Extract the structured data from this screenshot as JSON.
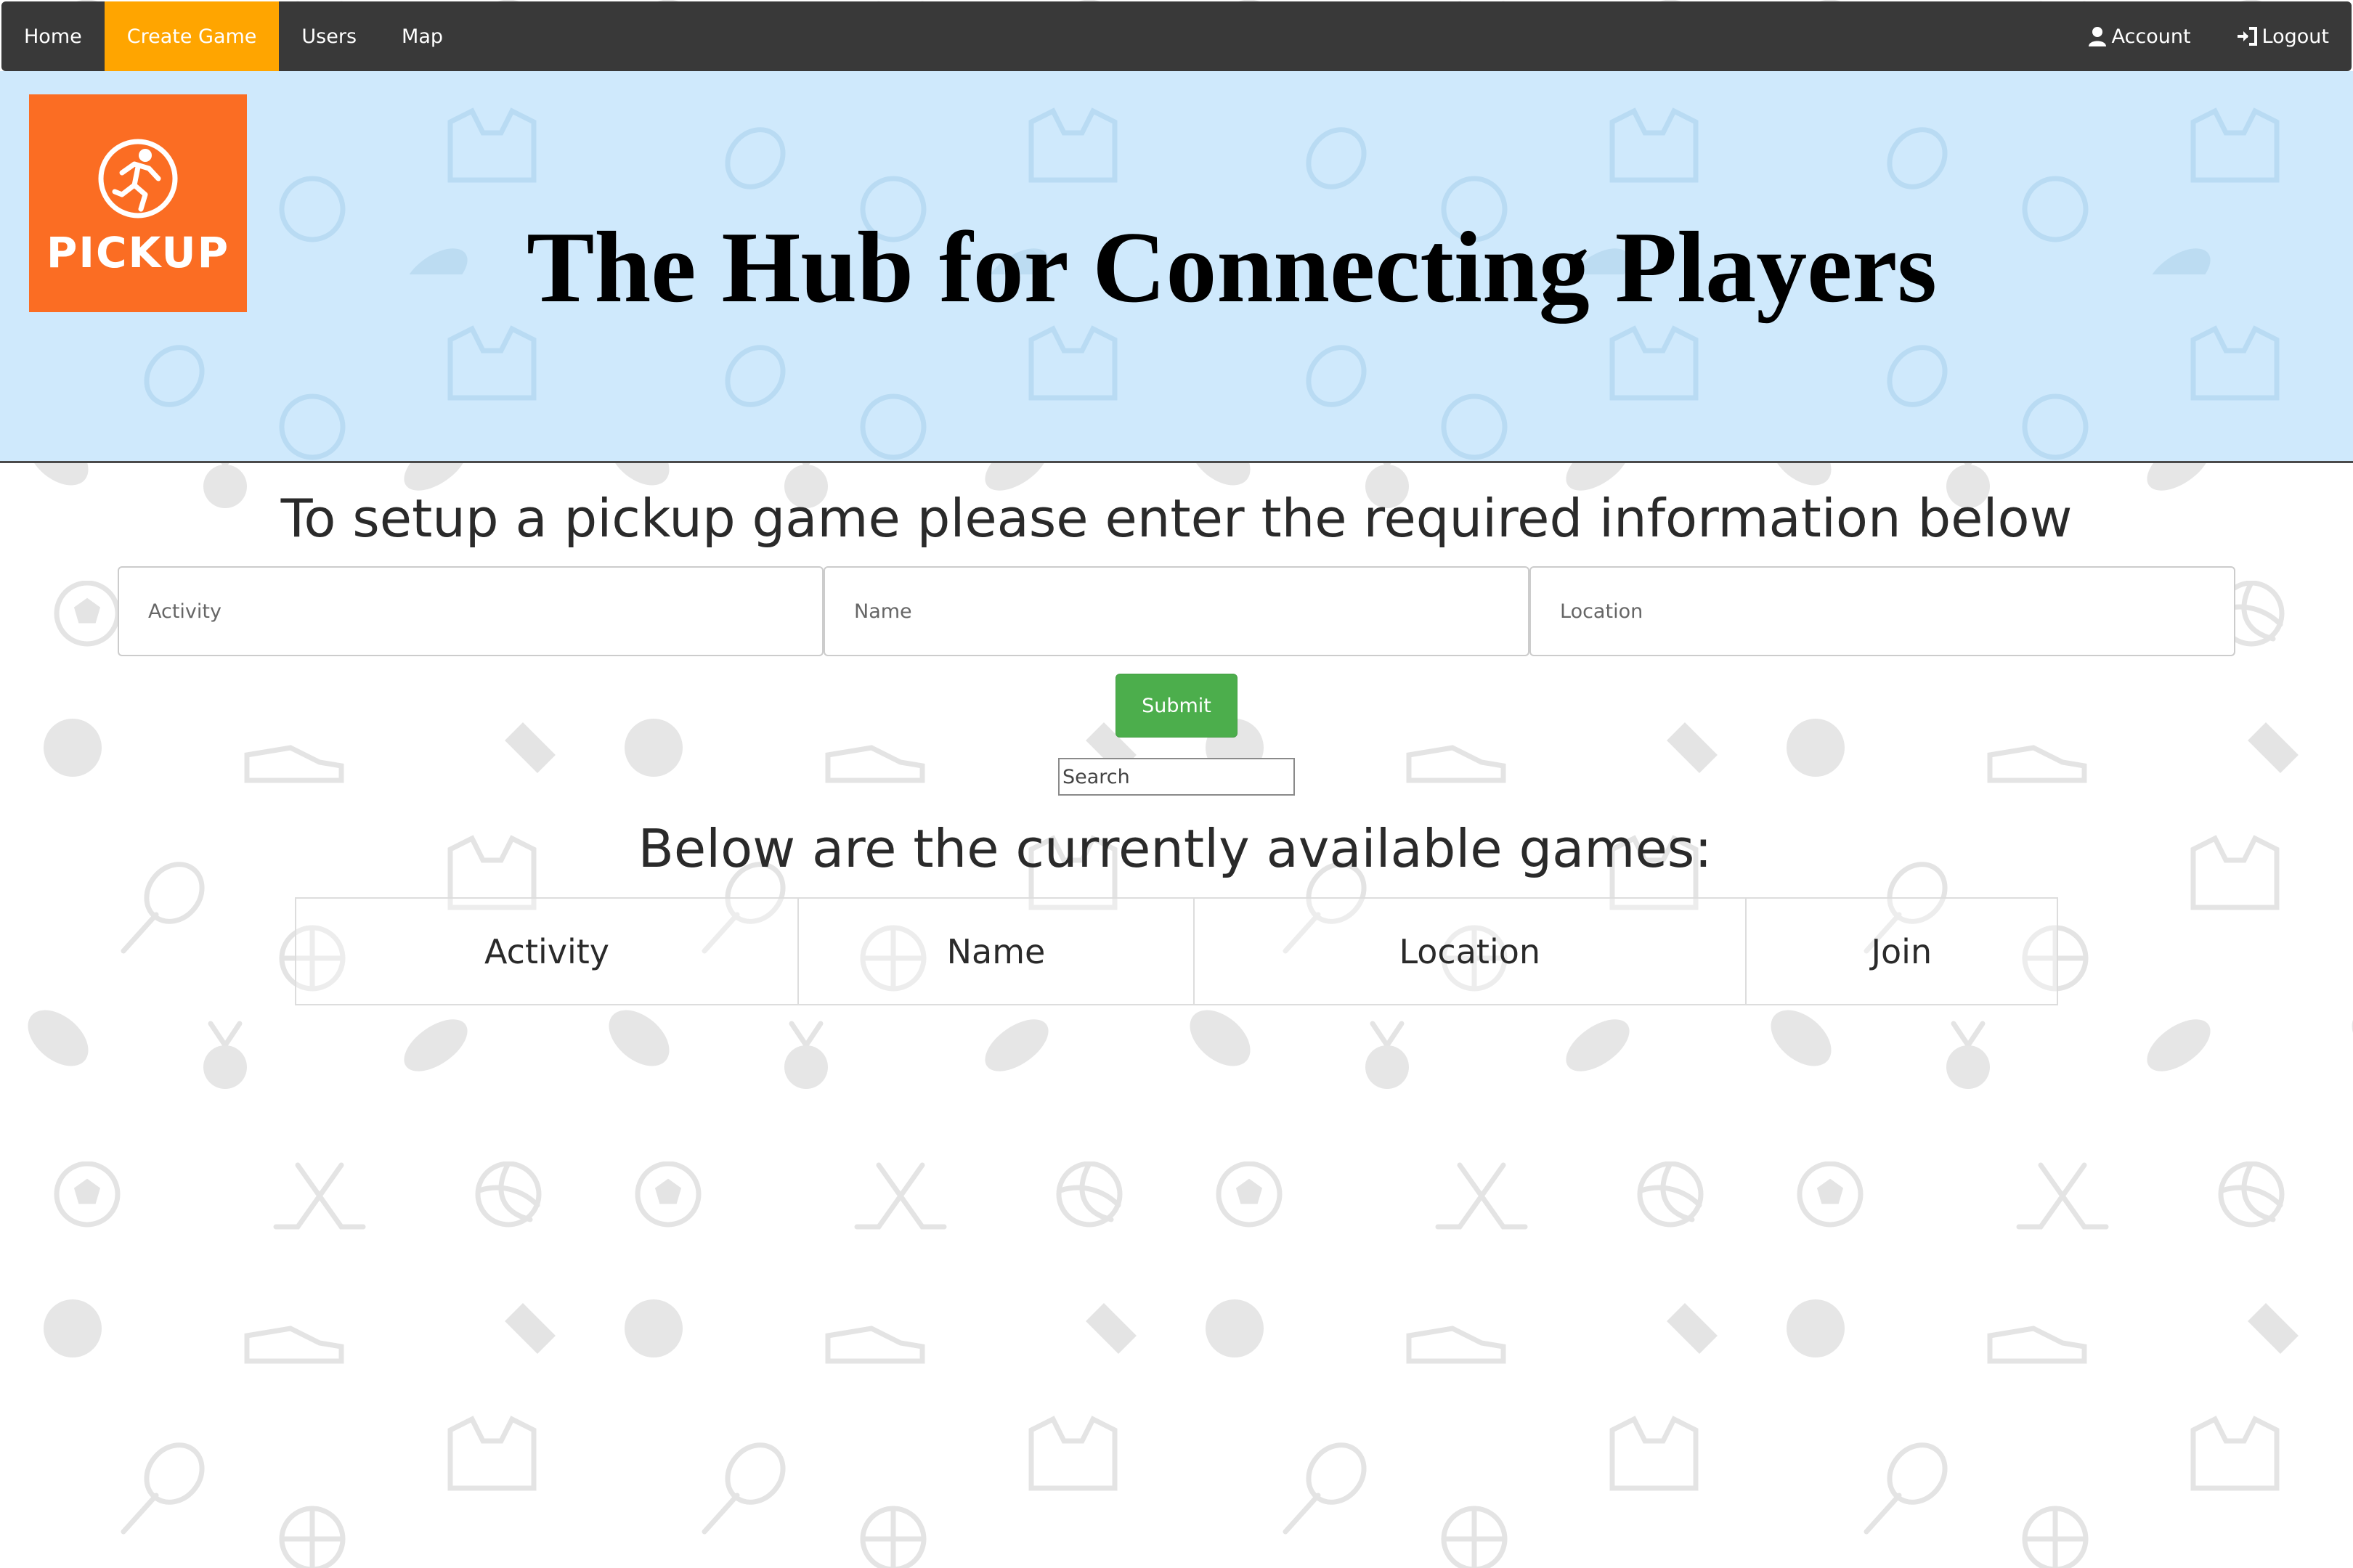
{
  "nav": {
    "items": [
      {
        "label": "Home",
        "active": false
      },
      {
        "label": "Create Game",
        "active": true
      },
      {
        "label": "Users",
        "active": false
      },
      {
        "label": "Map",
        "active": false
      }
    ],
    "account_label": "Account",
    "account_icon": "user-icon",
    "logout_label": "Logout",
    "logout_icon": "log-in-icon"
  },
  "hero": {
    "logo_text": "PICKUP",
    "logo_icon": "runner-icon",
    "title": "The Hub for Connecting Players"
  },
  "form": {
    "heading": "To setup a pickup game please enter the required information below",
    "activity_placeholder": "Activity",
    "name_placeholder": "Name",
    "location_placeholder": "Location",
    "submit_label": "Submit"
  },
  "search": {
    "placeholder": "Search"
  },
  "games": {
    "heading": "Below are the currently available games:",
    "columns": [
      "Activity",
      "Name",
      "Location",
      "Join"
    ],
    "rows": []
  },
  "colors": {
    "navbar": "#393939",
    "active_nav": "#ffa500",
    "hero_bg": "#cfe9fc",
    "logo_bg": "#fb6d23",
    "submit_bg": "#4cae4c"
  }
}
